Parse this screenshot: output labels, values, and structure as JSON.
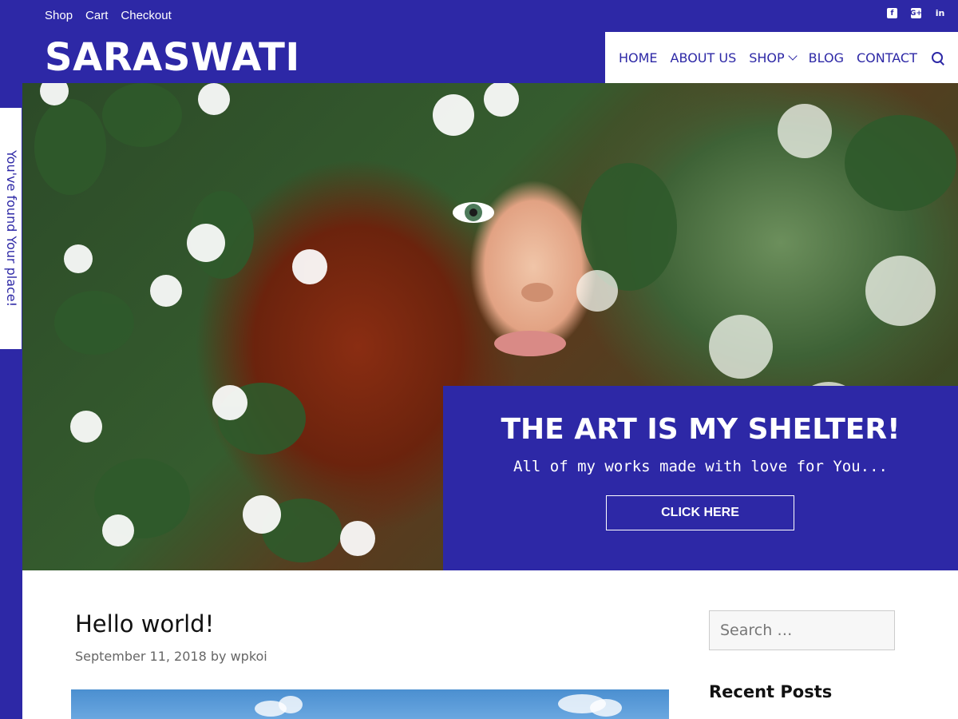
{
  "colors": {
    "brand": "#2d28a6",
    "background": "#ffffff",
    "text_dark": "#111111",
    "meta": "#666666"
  },
  "top_links": [
    "Shop",
    "Cart",
    "Checkout"
  ],
  "socials": [
    "facebook-icon",
    "google-plus-icon",
    "linkedin-icon"
  ],
  "site": {
    "title": "SARASWATI"
  },
  "nav": {
    "items": [
      "HOME",
      "ABOUT US",
      "SHOP",
      "BLOG",
      "CONTACT"
    ]
  },
  "side_tab": {
    "label": "You've found Your place!"
  },
  "hero": {
    "title": "THE ART IS MY SHELTER!",
    "subtitle": "All of my works made with love for You...",
    "button_label": "CLICK HERE"
  },
  "post": {
    "title": "Hello world!",
    "meta": "September 11, 2018 by wpkoi"
  },
  "sidebar": {
    "search_placeholder": "Search …",
    "recent_posts_title": "Recent Posts"
  }
}
